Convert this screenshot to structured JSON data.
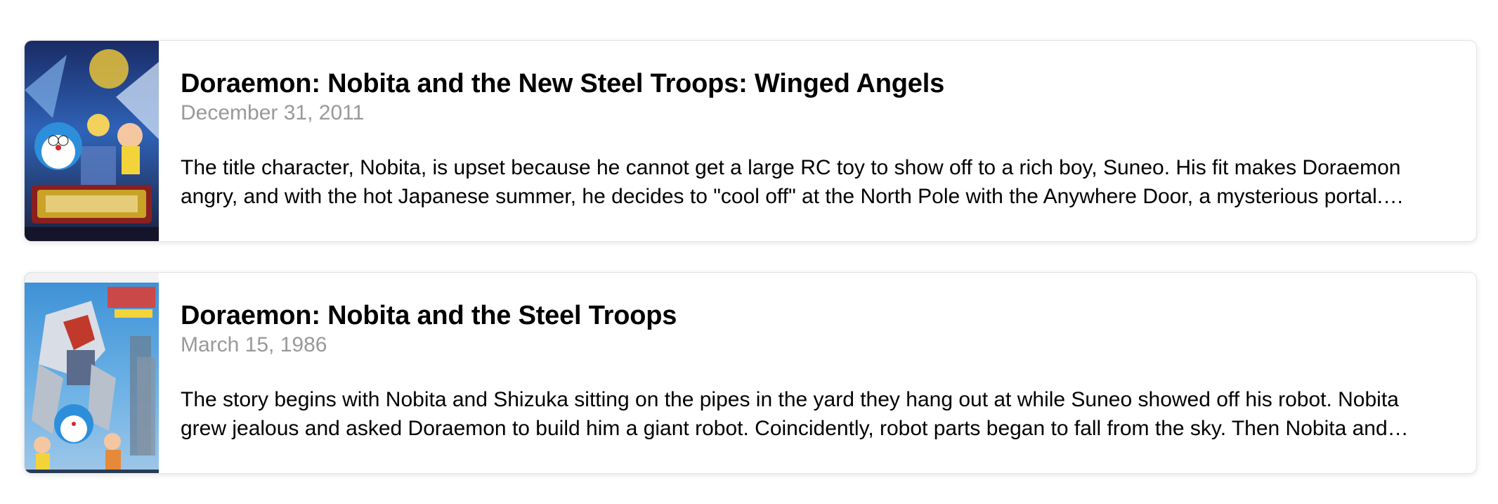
{
  "results": [
    {
      "title": "Doraemon: Nobita and the New Steel Troops: Winged Angels",
      "release_date": "December 31, 2011",
      "overview": "The title character, Nobita, is upset because he cannot get a large RC toy to show off to a rich boy, Suneo. His fit makes Doraemon angry, and with the hot Japanese summer, he decides to \"cool off\" at the North Pole with the Anywhere Door, a mysterious portal. While there, Nobita finds a strange object that looks like a bowling ball.",
      "poster_icon": "poster-image"
    },
    {
      "title": "Doraemon: Nobita and the Steel Troops",
      "release_date": "March 15, 1986",
      "overview": "The story begins with Nobita and Shizuka sitting on the pipes in the yard they hang out at while Suneo showed off his robot. Nobita grew jealous and asked Doraemon to build him a giant robot. Coincidently, robot parts began to fall from the sky. Then Nobita and Doraemon assemble the robot.",
      "poster_icon": "poster-image"
    }
  ],
  "colors": {
    "card_border": "#e3e3e3",
    "date_text": "#999999",
    "title_text": "#000000"
  }
}
